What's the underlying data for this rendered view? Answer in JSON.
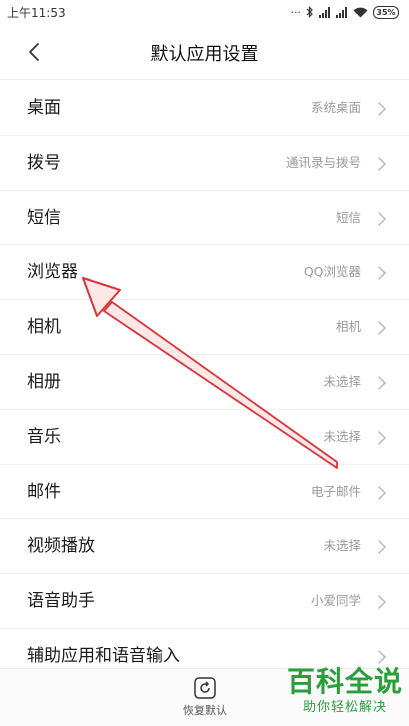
{
  "status_bar": {
    "time": "上午11:53",
    "battery": "35%"
  },
  "header": {
    "title": "默认应用设置"
  },
  "settings": [
    {
      "label": "桌面",
      "value": "系统桌面"
    },
    {
      "label": "拨号",
      "value": "通讯录与拨号"
    },
    {
      "label": "短信",
      "value": "短信"
    },
    {
      "label": "浏览器",
      "value": "QQ浏览器"
    },
    {
      "label": "相机",
      "value": "相机"
    },
    {
      "label": "相册",
      "value": "未选择"
    },
    {
      "label": "音乐",
      "value": "未选择"
    },
    {
      "label": "邮件",
      "value": "电子邮件"
    },
    {
      "label": "视频播放",
      "value": "未选择"
    },
    {
      "label": "语音助手",
      "value": "小爱同学"
    },
    {
      "label": "辅助应用和语音输入",
      "value": ""
    }
  ],
  "bottom_bar": {
    "restore_label": "恢复默认"
  },
  "watermark": {
    "main": "百科全说",
    "sub": "助你轻松解决"
  },
  "colors": {
    "annotation_arrow": "#d9353a",
    "watermark": "#2b9e3c",
    "value_text": "#9a9a9a"
  }
}
